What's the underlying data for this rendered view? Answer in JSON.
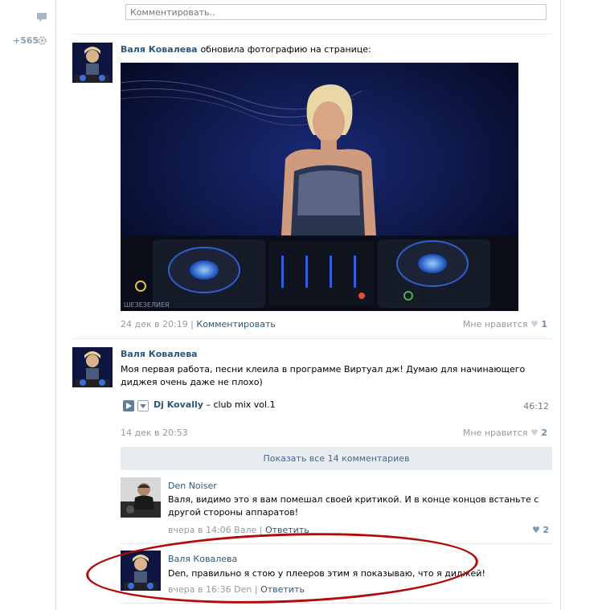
{
  "sidebar": {
    "counter": "+565"
  },
  "top_comment": {
    "placeholder": "Комментировать.."
  },
  "post1": {
    "author": "Валя Ковалева",
    "action": "обновила фотографию на странице:",
    "date": "24 дек в 20:19",
    "comment_link": "Комментировать",
    "like_label": "Мне нравится",
    "like_count": "1",
    "photo_watermark": "ШЕЗЕЗЕЛИЕЯ"
  },
  "post2": {
    "author": "Валя Ковалева",
    "text": "Моя первая работа, песни клеила в программе Виртуал дж! Думаю для начинающего диджея очень даже не плохо)",
    "audio": {
      "artist": "Dj Kovally",
      "dash": " – ",
      "title": "club mix vol.1",
      "duration": "46:12"
    },
    "date": "14 дек в 20:53",
    "like_label": "Мне нравится",
    "like_count": "2",
    "show_all": "Показать все 14 комментариев"
  },
  "comments": [
    {
      "author": "Den Noiser",
      "text": "Валя, видимо это я вам помешал своей критикой. И в конце концов встаньте с другой стороны аппаратов!",
      "meta_time": "вчера в 14:06",
      "meta_to": "Вале",
      "reply": "Ответить",
      "likes": "2"
    },
    {
      "author": "Валя Ковалева",
      "text": "Den, правильно я стою у плееров этим я показываю, что я диджей!",
      "meta_time": "вчера в 16:36",
      "meta_to": "Den",
      "reply": "Ответить"
    }
  ],
  "colors": {
    "link": "#2b587a",
    "accent_red": "#b30a0a",
    "show_all_bg": "#e8ecf0"
  },
  "icons": [
    "comment-bubble-icon",
    "gear-icon",
    "heart-icon",
    "play-icon",
    "add-audio-icon"
  ]
}
